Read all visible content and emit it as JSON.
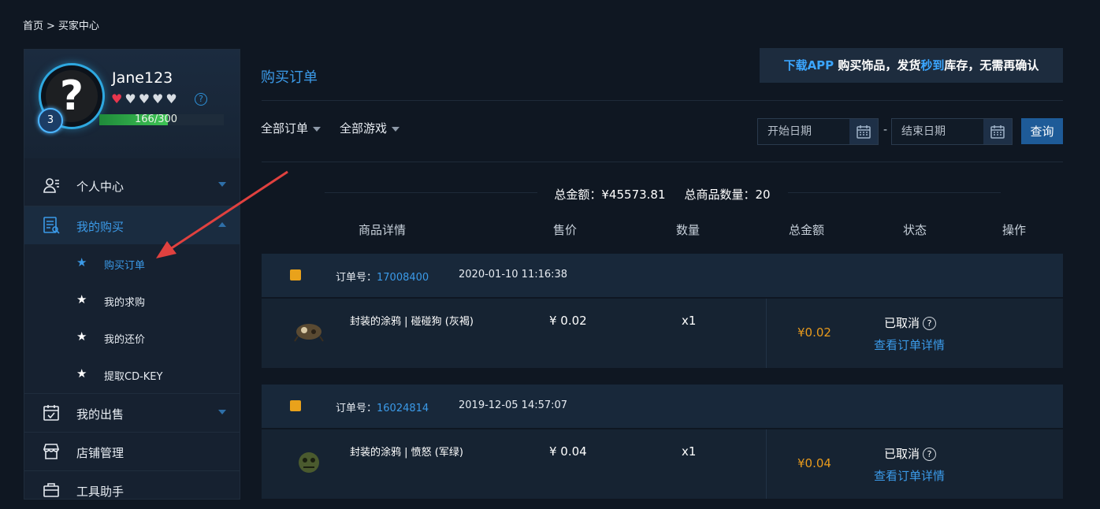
{
  "breadcrumb": {
    "home": "首页",
    "sep": ">",
    "current": "买家中心"
  },
  "profile": {
    "username": "Jane123",
    "level": "3",
    "xp_text": "166/300",
    "xp_progress": 0.553,
    "hearts_filled": 1,
    "hearts_total": 5,
    "avatar_glyph": "?",
    "help_glyph": "?"
  },
  "sidebar": {
    "personal_center": "个人中心",
    "my_purchases": "我的购买",
    "sub": {
      "purchase_orders": "购买订单",
      "my_requests": "我的求购",
      "my_offers": "我的还价",
      "cdkey": "提取CD-KEY"
    },
    "my_sales": "我的出售",
    "store_mgmt": "店铺管理",
    "tools": "工具助手"
  },
  "page": {
    "title": "购买订单",
    "promo": {
      "part1": "下载APP",
      "part2": " 购买饰品，发货",
      "part3": "秒到",
      "part4": "库存，无需再确认"
    }
  },
  "filters": {
    "all_orders": "全部订单",
    "all_games": "全部游戏",
    "start_placeholder": "开始日期",
    "end_placeholder": "结束日期",
    "dash": "-",
    "query": "查询"
  },
  "summary": {
    "total_amount": "总金额：¥45573.81",
    "total_items": "总商品数量：20"
  },
  "columns": {
    "detail": "商品详情",
    "price": "售价",
    "qty": "数量",
    "total": "总金额",
    "status": "状态",
    "action": "操作"
  },
  "orders": [
    {
      "no_label": "订单号：",
      "no": "17008400",
      "time": "2020-01-10 11:16:38",
      "item": "封装的涂鸦 | 碰碰狗 (灰褐)",
      "price": "¥ 0.02",
      "qty": "x1",
      "total": "¥0.02",
      "status": "已取消",
      "status_glyph": "?",
      "detail": "查看订单详情"
    },
    {
      "no_label": "订单号：",
      "no": "16024814",
      "time": "2019-12-05 14:57:07",
      "item": "封装的涂鸦 | 愤怒 (军绿)",
      "price": "¥ 0.04",
      "qty": "x1",
      "total": "¥0.04",
      "status": "已取消",
      "status_glyph": "?",
      "detail": "查看订单详情"
    }
  ],
  "colors": {
    "accent": "#3b9ae8",
    "price": "#e89a1c",
    "bg": "#0f1722"
  }
}
